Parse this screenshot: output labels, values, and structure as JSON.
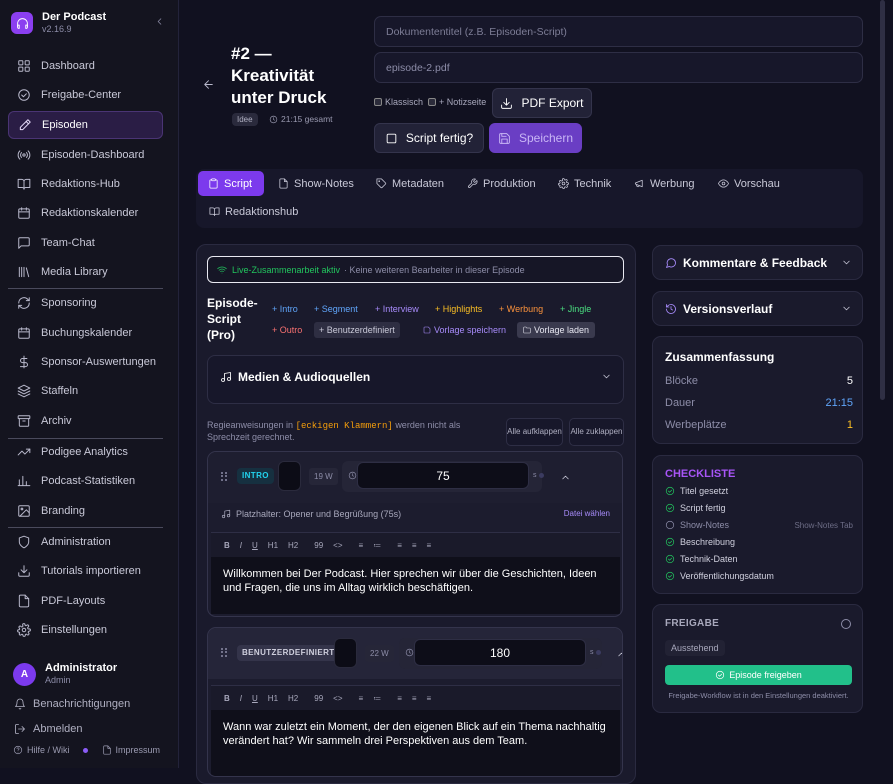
{
  "brand": {
    "name": "Der Podcast",
    "version": "v2.16.9"
  },
  "nav": [
    {
      "label": "Dashboard",
      "icon": "grid-icon",
      "id": "dashboard"
    },
    {
      "label": "Freigabe-Center",
      "icon": "check-circle-icon",
      "id": "freigabe-center"
    },
    {
      "label": "Episoden",
      "icon": "pen-icon",
      "id": "episoden",
      "active": true
    },
    {
      "label": "Episoden-Dashboard",
      "icon": "broadcast-icon",
      "id": "episoden-dashboard"
    },
    {
      "label": "Redaktions-Hub",
      "icon": "book-icon",
      "id": "redaktions-hub"
    },
    {
      "label": "Redaktionskalender",
      "icon": "calendar-icon",
      "id": "redaktionskalender"
    },
    {
      "label": "Team-Chat",
      "icon": "chat-icon",
      "id": "team-chat"
    },
    {
      "label": "Media Library",
      "icon": "library-icon",
      "id": "media-library"
    },
    {
      "label": "Sponsoring",
      "icon": "refresh-icon",
      "id": "sponsoring"
    },
    {
      "label": "Buchungskalender",
      "icon": "calendar-icon",
      "id": "buchungskalender"
    },
    {
      "label": "Sponsor-Auswertungen",
      "icon": "dollar-icon",
      "id": "sponsor-auswertungen"
    },
    {
      "label": "Staffeln",
      "icon": "layers-icon",
      "id": "staffeln"
    },
    {
      "label": "Archiv",
      "icon": "archive-icon",
      "id": "archiv"
    },
    {
      "label": "Podigee Analytics",
      "icon": "trend-icon",
      "id": "podigee-analytics"
    },
    {
      "label": "Podcast-Statistiken",
      "icon": "bar-chart-icon",
      "id": "podcast-statistiken"
    },
    {
      "label": "Branding",
      "icon": "image-icon",
      "id": "branding"
    },
    {
      "label": "Administration",
      "icon": "shield-icon",
      "id": "administration"
    },
    {
      "label": "Tutorials importieren",
      "icon": "download-icon",
      "id": "tutorials-importieren"
    },
    {
      "label": "PDF-Layouts",
      "icon": "file-icon",
      "id": "pdf-layouts"
    },
    {
      "label": "Einstellungen",
      "icon": "gear-icon",
      "id": "einstellungen"
    }
  ],
  "user": {
    "initial": "A",
    "name": "Administrator",
    "role": "Admin"
  },
  "side_links": {
    "notifications": "Benachrichtigungen",
    "logout": "Abmelden",
    "help": "Hilfe / Wiki",
    "imprint": "Impressum"
  },
  "episode": {
    "title": "#2 — Kreativität unter Druck",
    "status": "Idee",
    "duration": "21:15 gesamt"
  },
  "doc": {
    "title_placeholder": "Dokumententitel (z.B. Episoden-Script)",
    "filename": "episode-2.pdf"
  },
  "options": {
    "classic": "Klassisch",
    "notes": "+ Notizseite"
  },
  "buttons": {
    "pdf": "PDF Export",
    "done": "Script fertig?",
    "save": "Speichern"
  },
  "tabs": [
    {
      "label": "Script",
      "icon": "clipboard-icon",
      "active": true
    },
    {
      "label": "Show-Notes",
      "icon": "file-icon"
    },
    {
      "label": "Metadaten",
      "icon": "tag-icon"
    },
    {
      "label": "Produktion",
      "icon": "wrench-icon"
    },
    {
      "label": "Technik",
      "icon": "gear-icon"
    },
    {
      "label": "Werbung",
      "icon": "megaphone-icon"
    },
    {
      "label": "Vorschau",
      "icon": "eye-icon"
    },
    {
      "label": "Redaktionshub",
      "icon": "book-icon"
    }
  ],
  "live": {
    "active": "Live-Zusammenarbeit aktiv",
    "info": "· Keine weiteren Bearbeiter in dieser Episode"
  },
  "script": {
    "label": "Episode-Script (Pro)"
  },
  "chips": [
    {
      "label": "+ Intro",
      "color": "#60a5fa"
    },
    {
      "label": "+ Segment",
      "color": "#60a5fa"
    },
    {
      "label": "+ Interview",
      "color": "#a78bfa"
    },
    {
      "label": "+ Highlights",
      "color": "#fbbf24"
    },
    {
      "label": "+ Werbung",
      "color": "#fb923c"
    },
    {
      "label": "+ Jingle",
      "color": "#4ade80"
    },
    {
      "label": "+ Outro",
      "color": "#f87171"
    },
    {
      "label": "+ Benutzerdefiniert",
      "color": "#c9c9d8"
    },
    {
      "label": "Vorlage speichern",
      "color": "#a78bfa"
    },
    {
      "label": "Vorlage laden",
      "color": "#e6e6f0"
    }
  ],
  "media": {
    "title": "Medien & Audioquellen"
  },
  "hint": {
    "before": "Regieanweisungen in",
    "code": "[eckigen Klammern]",
    "after": "werden nicht als Sprechzeit gerechnet."
  },
  "expand": {
    "open": "Alle aufklappen",
    "close": "Alle zuklappen"
  },
  "blocks": [
    {
      "tag": "INTRO",
      "words": "19 W",
      "seconds": "75",
      "unit": "s",
      "placeholder": "Platzhalter: Opener und Begrüßung (75s)",
      "pick": "Datei wählen",
      "text": "Willkommen bei Der Podcast. Hier sprechen wir über die Geschichten, Ideen und Fragen, die uns im Alltag wirklich beschäftigen."
    },
    {
      "tag": "BENUTZERDEFINIERT",
      "words": "22 W",
      "seconds": "180",
      "unit": "s",
      "text": "Wann war zuletzt ein Moment, der den eigenen Blick auf ein Thema nachhaltig verändert hat? Wir sammeln drei Perspektiven aus dem Team."
    }
  ],
  "toolbar": [
    "B",
    "I",
    "U",
    "H1",
    "H2",
    "99",
    "<>",
    "≡",
    "≔",
    "≡",
    "≡",
    "≡"
  ],
  "comments": {
    "title": "Kommentare & Feedback"
  },
  "versions": {
    "title": "Versionsverlauf"
  },
  "summary": {
    "title": "Zusammenfassung",
    "rows": [
      {
        "label": "Blöcke",
        "value": "5",
        "color": "#ffffff"
      },
      {
        "label": "Dauer",
        "value": "21:15",
        "color": "#60a5fa"
      },
      {
        "label": "Werbeplätze",
        "value": "1",
        "color": "#fbbf24"
      }
    ]
  },
  "checklist": {
    "title": "CHECKLISTE",
    "items": [
      {
        "label": "Titel gesetzt",
        "done": true
      },
      {
        "label": "Script fertig",
        "done": true
      },
      {
        "label": "Show-Notes",
        "done": false,
        "note": "Show-Notes Tab"
      },
      {
        "label": "Beschreibung",
        "done": true
      },
      {
        "label": "Technik-Daten",
        "done": true
      },
      {
        "label": "Veröffentlichungsdatum",
        "done": true
      }
    ]
  },
  "release": {
    "title": "FREIGABE",
    "status": "Ausstehend",
    "button": "Episode freigeben",
    "note": "Freigabe-Workflow ist in den Einstellungen deaktiviert."
  }
}
